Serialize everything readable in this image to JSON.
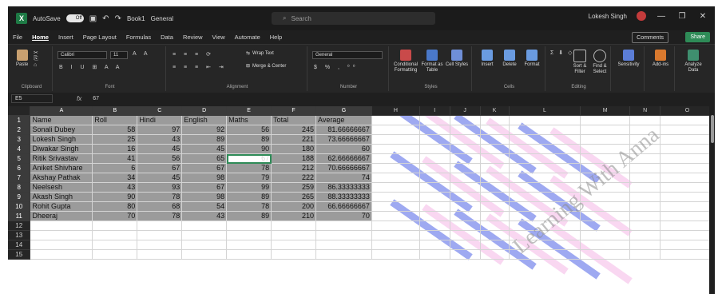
{
  "titlebar": {
    "autosave": "AutoSave",
    "toggle": "Off",
    "doc": "Book1",
    "privacy": "General",
    "search_placeholder": "Search",
    "user": "Lokesh Singh"
  },
  "menu": [
    "File",
    "Home",
    "Insert",
    "Page Layout",
    "Formulas",
    "Data",
    "Review",
    "View",
    "Automate",
    "Help"
  ],
  "menu_active": "Home",
  "comments": "Comments",
  "share": "Share",
  "ribbon": {
    "paste": "Paste",
    "clipboard": "Clipboard",
    "font_name": "Calibri",
    "font_size": "11",
    "font": "Font",
    "wrap": "Wrap Text",
    "merge": "Merge & Center",
    "alignment": "Alignment",
    "numfmt": "General",
    "number": "Number",
    "cond": "Conditional Formatting",
    "fmt_table": "Format as Table",
    "cell_styles": "Cell Styles",
    "styles": "Styles",
    "insert": "Insert",
    "delete": "Delete",
    "format": "Format",
    "cells": "Cells",
    "sortfilter": "Sort & Filter",
    "findselect": "Find & Select",
    "editing": "Editing",
    "sensitivity": "Sensitivity",
    "addins": "Add-ins",
    "analyze": "Analyze Data"
  },
  "formula": {
    "cell": "E5",
    "fx": "fx",
    "value": "67"
  },
  "columns": [
    "A",
    "B",
    "C",
    "D",
    "E",
    "F",
    "G",
    "H",
    "I",
    "J",
    "K",
    "L",
    "M",
    "N",
    "O"
  ],
  "rows": [
    [
      "Name",
      "Roll",
      "Hindi",
      "English",
      "Maths",
      "Total",
      "Average"
    ],
    [
      "Sonali Dubey",
      "58",
      "97",
      "92",
      "56",
      "245",
      "81.66666667"
    ],
    [
      "Lokesh Singh",
      "25",
      "43",
      "89",
      "89",
      "221",
      "73.66666667"
    ],
    [
      "Diwakar Singh",
      "16",
      "45",
      "45",
      "90",
      "180",
      "60"
    ],
    [
      "Ritik Srivastav",
      "41",
      "56",
      "65",
      "67",
      "188",
      "62.66666667"
    ],
    [
      "Aniket Shivhare",
      "6",
      "67",
      "67",
      "78",
      "212",
      "70.66666667"
    ],
    [
      "Akshay Pathak",
      "34",
      "45",
      "98",
      "79",
      "222",
      "74"
    ],
    [
      "Neelsesh",
      "43",
      "93",
      "67",
      "99",
      "259",
      "86.33333333"
    ],
    [
      "Akash Singh",
      "90",
      "78",
      "98",
      "89",
      "265",
      "88.33333333"
    ],
    [
      "Rohit Gupta",
      "80",
      "68",
      "54",
      "78",
      "200",
      "66.66666667"
    ],
    [
      "Dheeraj",
      "70",
      "78",
      "43",
      "89",
      "210",
      "70"
    ]
  ],
  "row_numbers": [
    "1",
    "2",
    "3",
    "4",
    "5",
    "6",
    "7",
    "8",
    "9",
    "10",
    "11",
    "12",
    "13",
    "14",
    "15"
  ],
  "watermark": "Learning With Anna",
  "colors": {
    "accent": "#2e8b57",
    "stripe_blue": "#4f63e6",
    "stripe_pink": "#f4b6e6"
  }
}
